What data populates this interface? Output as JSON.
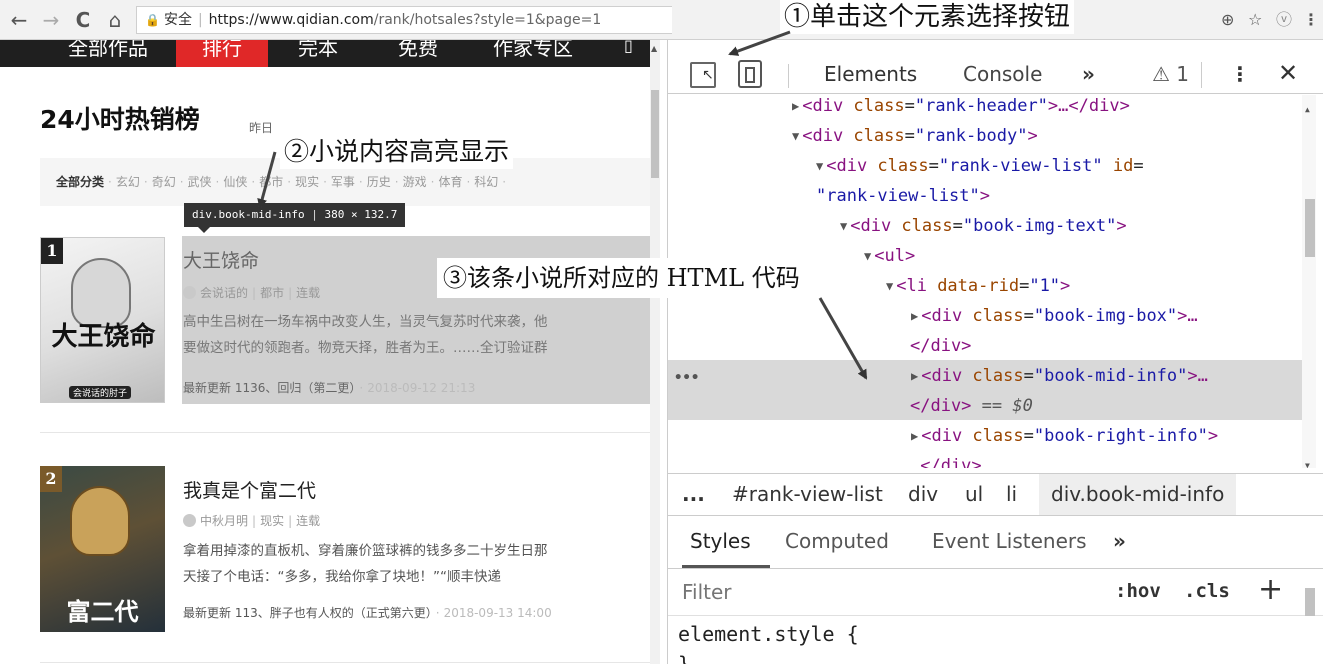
{
  "browser": {
    "security_label": "安全",
    "url_host": "https://www.qidian.com",
    "url_path": "/rank/hotsales?style=1&page=1",
    "nav": {
      "back": "←",
      "forward": "→",
      "reload": "C",
      "home": "⌂"
    },
    "right_icons": {
      "zoom": "⊕",
      "star": "☆",
      "ext": "ⓥ",
      "menu": "⋮"
    }
  },
  "annotations": {
    "step1": "①单击这个元素选择按钮",
    "step2": "②小说内容高亮显示",
    "step3": "③该条小说所对应的 HTML 代码"
  },
  "site": {
    "nav": [
      "全部作品",
      "排行",
      "完本",
      "免费",
      "作家专区"
    ],
    "rank_title": "24小时热销榜",
    "rank_sub": "昨日",
    "categories": [
      "全部分类",
      "玄幻",
      "奇幻",
      "武侠",
      "仙侠",
      "都市",
      "现实",
      "军事",
      "历史",
      "游戏",
      "体育",
      "科幻"
    ],
    "tooltip": {
      "selector": "div.book-mid-info",
      "size": "380 × 132.7"
    },
    "books": [
      {
        "rank": "1",
        "cover_title": "大王饶命",
        "cover_author": "会说话的肘子",
        "title": "大王饶命",
        "author": "会说话的",
        "genre": "都市",
        "status": "连载",
        "intro_line1": "高中生吕树在一场车祸中改变人生，当灵气复苏时代来袭，他",
        "intro_line2": "要做这时代的领跑者。物竞天择，胜者为王。……全订验证群",
        "update_label": "最新更新 1136、回归（第二更）",
        "update_time": "2018-09-12 21:13"
      },
      {
        "rank": "2",
        "cover_title": "富二代",
        "title": "我真是个富二代",
        "author": "中秋月明",
        "genre": "现实",
        "status": "连载",
        "intro_line1": "拿着用掉漆的直板机、穿着廉价篮球裤的钱多多二十岁生日那",
        "intro_line2": "天接了个电话：“多多，我给你拿了块地！”“顺丰快递",
        "update_label": "最新更新 113、胖子也有人权的（正式第六更）",
        "update_time": "2018-09-13 14:00"
      }
    ]
  },
  "devtools": {
    "tabs": {
      "elements": "Elements",
      "console": "Console",
      "more": "»"
    },
    "warning_count": "1",
    "dom": {
      "l1": {
        "tag_open": "<div ",
        "attr": "class",
        "eq": "=",
        "val": "\"rank-header\"",
        "rest": ">…</div>"
      },
      "l2": {
        "tag_open": "<div ",
        "attr": "class",
        "eq": "=",
        "val": "\"rank-body\"",
        "rest": ">"
      },
      "l3": {
        "tag_open": "<div ",
        "attr": "class",
        "eq": "=",
        "val": "\"rank-view-list\"",
        "attr2": " id",
        "eq2": "="
      },
      "l3b": {
        "val": "\"rank-view-list\"",
        "rest": ">"
      },
      "l4": {
        "tag_open": "<div ",
        "attr": "class",
        "eq": "=",
        "val": "\"book-img-text\"",
        "rest": ">"
      },
      "l5": {
        "tag": "<ul>"
      },
      "l6": {
        "tag_open": "<li ",
        "attr": "data-rid",
        "eq": "=",
        "val": "\"1\"",
        "rest": ">"
      },
      "l7": {
        "tag_open": "<div ",
        "attr": "class",
        "eq": "=",
        "val": "\"book-img-box\"",
        "rest": ">…"
      },
      "l7b": {
        "tag": "</div>"
      },
      "l8": {
        "tag_open": "<div ",
        "attr": "class",
        "eq": "=",
        "val": "\"book-mid-info\"",
        "rest": ">…"
      },
      "l8b": {
        "tag": "</div>",
        "marker": " == $0"
      },
      "l9": {
        "tag_open": "<div ",
        "attr": "class",
        "eq": "=",
        "val": "\"book-right-info\"",
        "rest": ">"
      },
      "l9b": {
        "tag": "…</div>"
      }
    },
    "breadcrumbs": [
      "...",
      "#rank-view-list",
      "div",
      "ul",
      "li",
      "div.book-mid-info"
    ],
    "styles_tabs": {
      "styles": "Styles",
      "computed": "Computed",
      "events": "Event Listeners",
      "more": "»"
    },
    "filter_placeholder": "Filter",
    "hov": ":hov",
    "cls": ".cls",
    "plus": "+",
    "element_style": "element.style {",
    "element_style_close": "}"
  }
}
